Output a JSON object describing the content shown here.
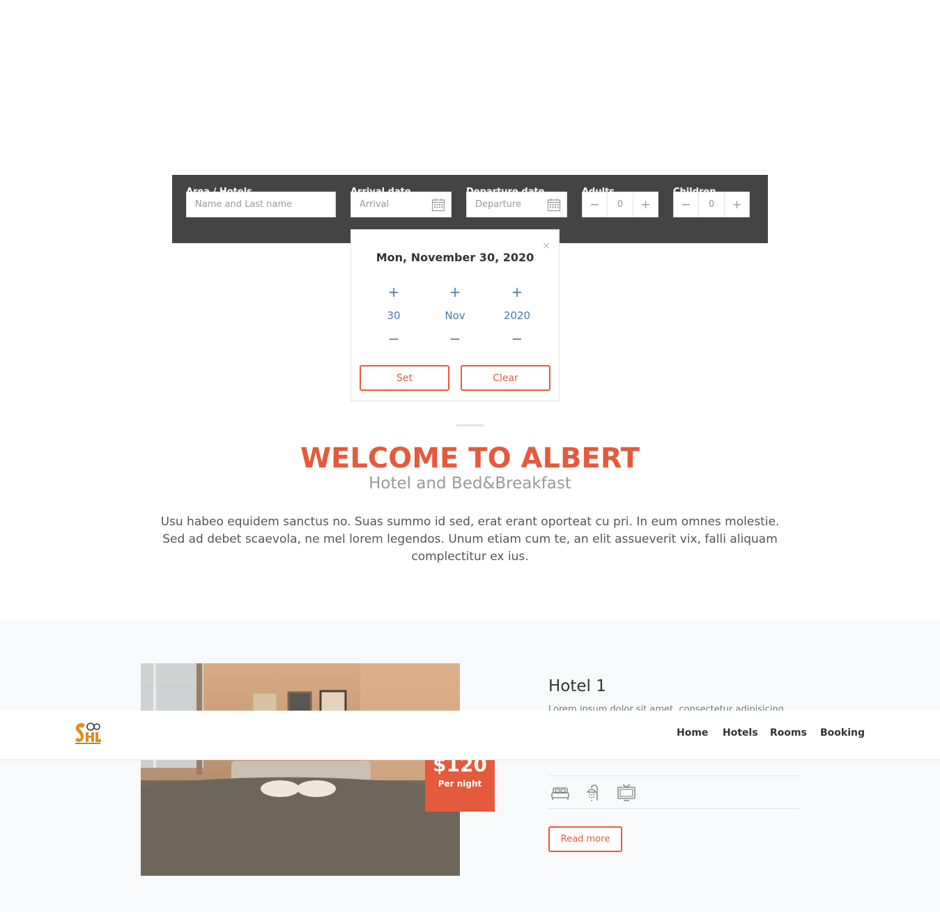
{
  "booking": {
    "area_label": "Area / Hotels",
    "area_placeholder": "Name and Last name",
    "arrival_label": "Arrival date",
    "arrival_placeholder": "Arrival",
    "departure_label": "Departure date",
    "departure_placeholder": "Departure",
    "adults_label": "Adults",
    "adults_value": "0",
    "children_label": "Children",
    "children_value": "0",
    "minus": "−",
    "plus": "+"
  },
  "datepicker": {
    "close": "×",
    "title": "Mon, November 30, 2020",
    "day": "30",
    "month": "Nov",
    "year": "2020",
    "plus": "+",
    "minus": "−",
    "set_label": "Set",
    "clear_label": "Clear"
  },
  "welcome": {
    "title": "WELCOME TO ALBERT",
    "subtitle": "Hotel and Bed&Breakfast",
    "text": "Usu habeo equidem sanctus no. Suas summo id sed, erat erant oporteat cu pri. In eum omnes molestie. Sed ad debet scaevola, ne mel lorem legendos. Unum etiam cum te, an elit assueverit vix, falli aliquam complectitur ex ius."
  },
  "hotel": {
    "name": "Hotel 1",
    "description": "Lorem ipsum dolor sit amet, consectetur adipisicing",
    "price": "$120",
    "price_unit": "Per night",
    "read_more": "Read more",
    "amenities": [
      "bed-icon",
      "shower-icon",
      "tv-icon"
    ]
  },
  "nav": {
    "links": [
      "Home",
      "Hotels",
      "Rooms",
      "Booking"
    ]
  },
  "colors": {
    "accent": "#e55a3c",
    "bar": "#444444",
    "picker_blue": "#4a7aa6"
  }
}
